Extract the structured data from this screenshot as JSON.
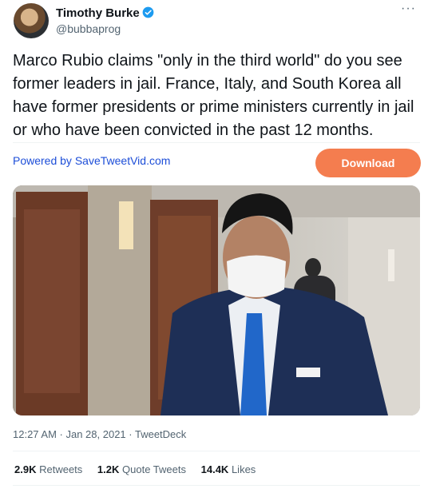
{
  "author": {
    "name": "Timothy Burke",
    "handle": "@bubbaprog"
  },
  "tweet": {
    "text": "Marco Rubio claims \"only in the third world\" do you see former leaders in jail. France, Italy, and South Korea all have former presidents or prime ministers currently in jail or who have been convicted in the past 12 months.",
    "more_label": "···",
    "powered_by": "Powered by SaveTweetVid.com",
    "download_label": "Download",
    "timestamp": "12:27 AM · Jan 28, 2021 · TweetDeck"
  },
  "stats": {
    "retweets_count": "2.9K",
    "retweets_label": "Retweets",
    "quotes_count": "1.2K",
    "quotes_label": "Quote Tweets",
    "likes_count": "14.4K",
    "likes_label": "Likes"
  },
  "colors": {
    "link": "#1d4ed8",
    "download_button": "#f47d4f",
    "verified": "#1d9bf0"
  },
  "icons": [
    "verified-badge-icon",
    "more-options-icon"
  ]
}
